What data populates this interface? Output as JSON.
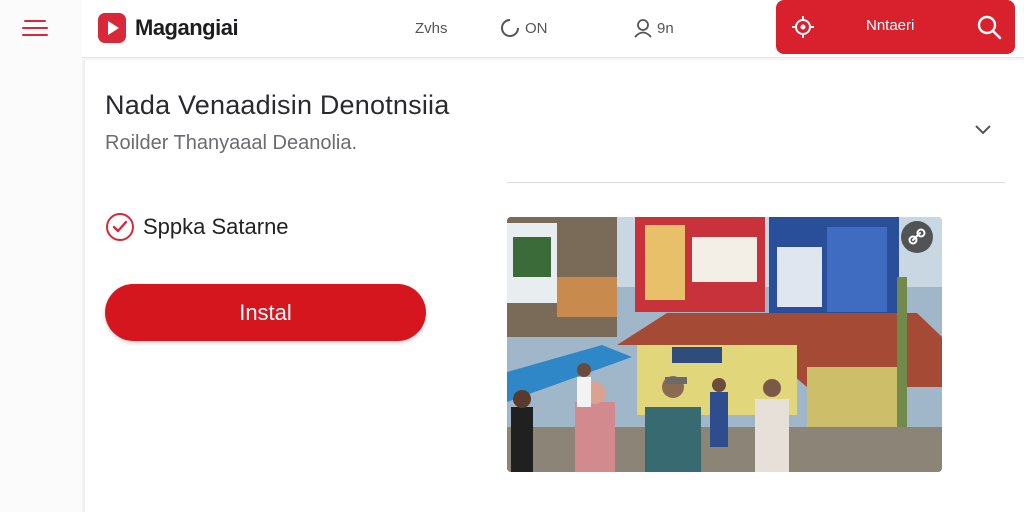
{
  "brand": {
    "name": "Magangiai"
  },
  "nav": [
    {
      "label": "Zvhs",
      "icon": "none"
    },
    {
      "label": "ON",
      "icon": "power-icon"
    },
    {
      "label": "9n",
      "icon": "person-icon"
    }
  ],
  "action": {
    "label": "Nntaeri",
    "icon": "target-icon",
    "search_icon": "search-icon"
  },
  "app": {
    "title": "Nada Venaadisin Denotnsiia",
    "subtitle": "Roilder Thanyaaal Deanolia."
  },
  "status": {
    "label": "Sppka Satarne",
    "icon": "check-circle-icon"
  },
  "install_label": "Instal",
  "colors": {
    "accent": "#d9212e",
    "install": "#d5161e",
    "menu": "#d8283a"
  },
  "media": {
    "description_icon": "link-icon"
  }
}
